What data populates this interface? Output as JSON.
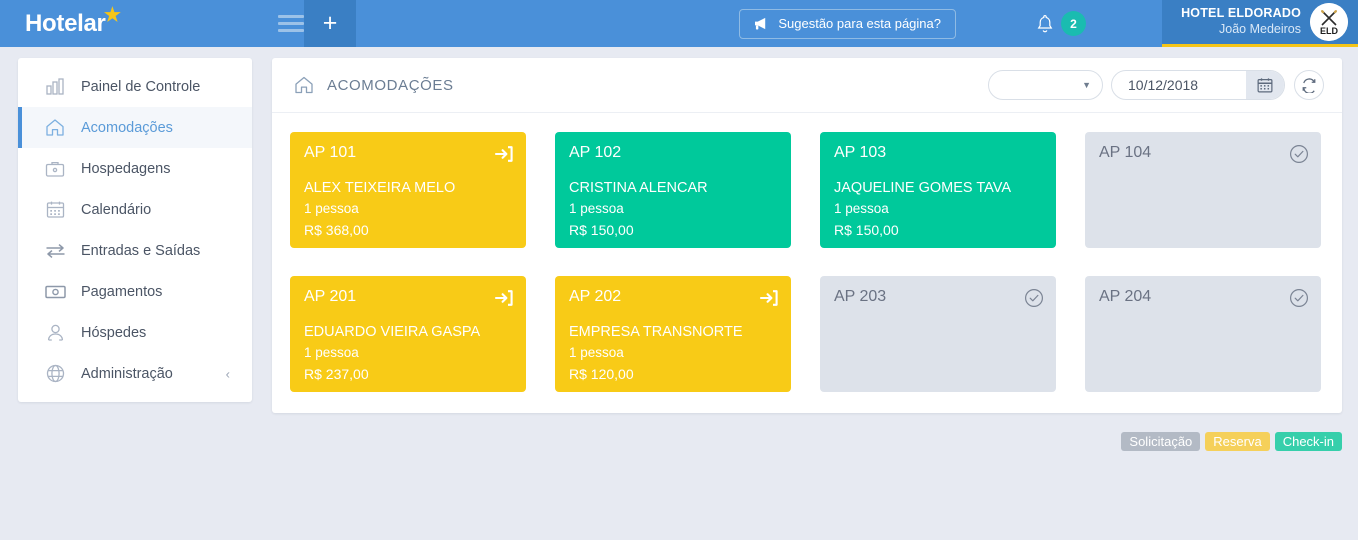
{
  "header": {
    "brand": "Hotelar",
    "brand_icon": "star-icon",
    "menu_icon": "hamburger-icon",
    "add_label": "+",
    "suggestion_label": "Sugestão para esta página?",
    "suggestion_icon": "megaphone-icon",
    "bell_icon": "bell-icon",
    "notification_count": "2",
    "account": {
      "hotel": "HOTEL ELDORADO",
      "user": "João Medeiros",
      "logo_text": "ELD"
    },
    "colors": {
      "bar": "#4a90d9",
      "bar_dark": "#3a7fc4",
      "accent": "#f5c518",
      "badge": "#1abcb0"
    }
  },
  "sidebar": {
    "items": [
      {
        "label": "Painel de Controle",
        "icon": "bar-chart-icon",
        "active": false
      },
      {
        "label": "Acomodações",
        "icon": "home-icon",
        "active": true
      },
      {
        "label": "Hospedagens",
        "icon": "briefcase-icon",
        "active": false
      },
      {
        "label": "Calendário",
        "icon": "calendar-icon",
        "active": false
      },
      {
        "label": "Entradas e Saídas",
        "icon": "exchange-arrows-icon",
        "active": false
      },
      {
        "label": "Pagamentos",
        "icon": "money-bill-icon",
        "active": false
      },
      {
        "label": "Hóspedes",
        "icon": "user-icon",
        "active": false
      },
      {
        "label": "Administração",
        "icon": "globe-icon",
        "active": false,
        "chevron": "‹"
      }
    ]
  },
  "panel": {
    "breadcrumb_icon": "home-icon",
    "breadcrumb_title": "ACOMODAÇÕES",
    "filter_select": {
      "value": "",
      "caret_icon": "chevron-down-icon"
    },
    "date_input": {
      "value": "10/12/2018",
      "icon": "calendar-icon"
    },
    "refresh_icon": "refresh-icon"
  },
  "rooms": [
    {
      "code": "AP 101",
      "guest": "ALEX TEIXEIRA MELO",
      "people": "1 pessoa",
      "price": "R$  368,00",
      "status": "reserva",
      "icon": "sign-in-icon"
    },
    {
      "code": "AP 102",
      "guest": "CRISTINA ALENCAR",
      "people": "1 pessoa",
      "price": "R$  150,00",
      "status": "checkin",
      "icon": ""
    },
    {
      "code": "AP 103",
      "guest": "JAQUELINE GOMES TAVA",
      "people": "1 pessoa",
      "price": "R$  150,00",
      "status": "checkin",
      "icon": ""
    },
    {
      "code": "AP 104",
      "guest": "",
      "people": "",
      "price": "",
      "status": "solicita",
      "icon": "check-circle-icon"
    },
    {
      "code": "AP 201",
      "guest": "EDUARDO VIEIRA GASPA",
      "people": "1 pessoa",
      "price": "R$  237,00",
      "status": "reserva",
      "icon": "sign-in-icon"
    },
    {
      "code": "AP 202",
      "guest": "EMPRESA TRANSNORTE",
      "people": "1 pessoa",
      "price": "R$  120,00",
      "status": "reserva",
      "icon": "sign-in-icon"
    },
    {
      "code": "AP 203",
      "guest": "",
      "people": "",
      "price": "",
      "status": "solicita",
      "icon": "check-circle-icon"
    },
    {
      "code": "AP 204",
      "guest": "",
      "people": "",
      "price": "",
      "status": "solicita",
      "icon": "check-circle-icon"
    }
  ],
  "legend": [
    {
      "label": "Solicitação",
      "status": "solicita",
      "color": "#b3bac5"
    },
    {
      "label": "Reserva",
      "status": "reserva",
      "color": "#f5d05a"
    },
    {
      "label": "Check-in",
      "status": "checkin",
      "color": "#36cfab"
    }
  ]
}
